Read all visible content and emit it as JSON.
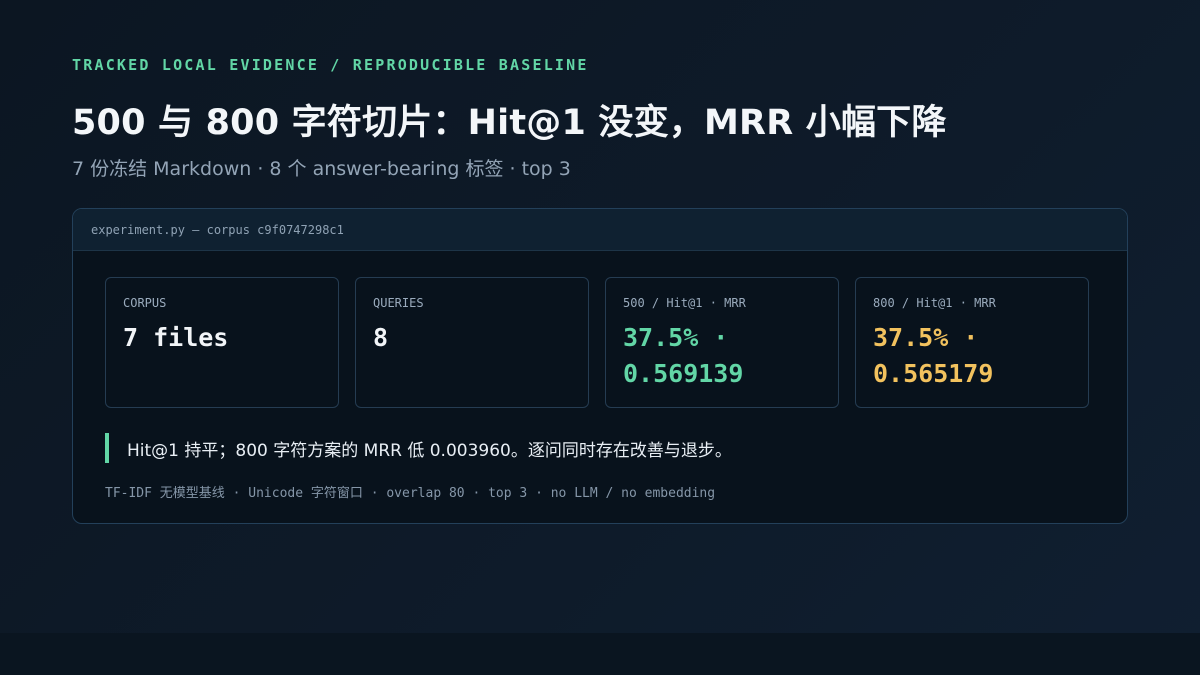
{
  "header": {
    "eyebrow": "TRACKED LOCAL EVIDENCE / REPRODUCIBLE BASELINE",
    "title": "500 与 800 字符切片：Hit@1 没变，MRR 小幅下降",
    "subtitle": "7 份冻结 Markdown · 8 个 answer-bearing 标签 · top 3"
  },
  "panel": {
    "header": "experiment.py — corpus c9f0747298c1",
    "cards": [
      {
        "label": "CORPUS",
        "value": "7 files"
      },
      {
        "label": "QUERIES",
        "value": "8"
      },
      {
        "label": "500 / Hit@1 · MRR",
        "value": "37.5% · 0.569139",
        "color": "#62d6a6"
      },
      {
        "label": "800 / Hit@1 · MRR",
        "value": "37.5% · 0.565179",
        "color": "#f2c25e"
      }
    ],
    "note": "Hit@1 持平；800 字符方案的 MRR 低 0.003960。逐问同时存在改善与退步。",
    "footnote": "TF-IDF 无模型基线 · Unicode 字符窗口 · overlap 80 · top 3 · no LLM / no embedding"
  }
}
